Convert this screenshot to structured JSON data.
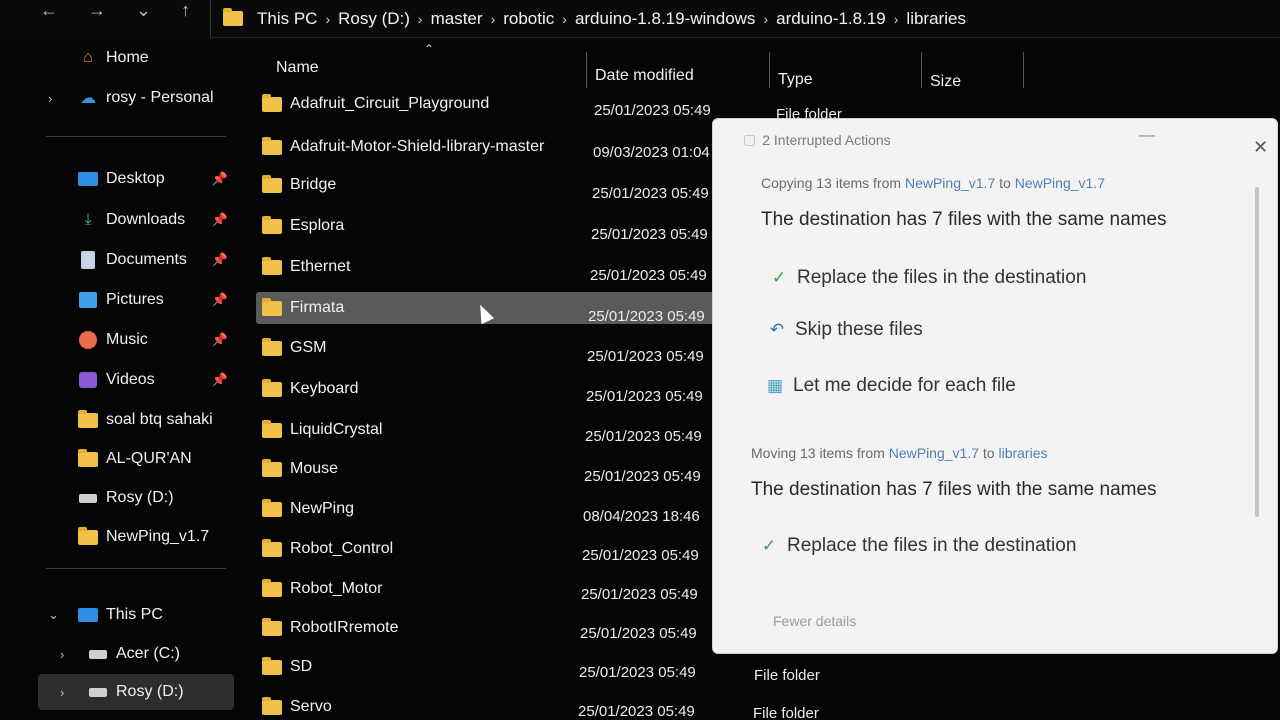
{
  "address_bar": {
    "crumbs": [
      "This PC",
      "Rosy (D:)",
      "master",
      "robotic",
      "arduino-1.8.19-windows",
      "arduino-1.8.19",
      "libraries"
    ]
  },
  "sidebar": {
    "home": "Home",
    "onedrive": "rosy - Personal",
    "pinned": [
      {
        "label": "Desktop",
        "icon": "desktop-icon"
      },
      {
        "label": "Downloads",
        "icon": "download-icon"
      },
      {
        "label": "Documents",
        "icon": "documents-icon"
      },
      {
        "label": "Pictures",
        "icon": "pictures-icon"
      },
      {
        "label": "Music",
        "icon": "music-icon"
      },
      {
        "label": "Videos",
        "icon": "videos-icon"
      }
    ],
    "folders": [
      "soal btq sahaki",
      "AL-QUR'AN",
      "Rosy (D:)",
      "NewPing_v1.7"
    ],
    "this_pc": "This PC",
    "drives": [
      "Acer (C:)",
      "Rosy (D:)"
    ]
  },
  "columns": {
    "name": "Name",
    "date": "Date modified",
    "type": "Type",
    "size": "Size"
  },
  "files": [
    {
      "name": "Adafruit_Circuit_Playground",
      "date": "25/01/2023 05:49"
    },
    {
      "name": "Adafruit-Motor-Shield-library-master",
      "date": "09/03/2023 01:04"
    },
    {
      "name": "Bridge",
      "date": "25/01/2023 05:49"
    },
    {
      "name": "Esplora",
      "date": "25/01/2023 05:49"
    },
    {
      "name": "Ethernet",
      "date": "25/01/2023 05:49"
    },
    {
      "name": "Firmata",
      "date": "25/01/2023 05:49"
    },
    {
      "name": "GSM",
      "date": "25/01/2023 05:49"
    },
    {
      "name": "Keyboard",
      "date": "25/01/2023 05:49"
    },
    {
      "name": "LiquidCrystal",
      "date": "25/01/2023 05:49"
    },
    {
      "name": "Mouse",
      "date": "25/01/2023 05:49"
    },
    {
      "name": "NewPing",
      "date": "08/04/2023 18:46"
    },
    {
      "name": "Robot_Control",
      "date": "25/01/2023 05:49"
    },
    {
      "name": "Robot_Motor",
      "date": "25/01/2023 05:49"
    },
    {
      "name": "RobotIRremote",
      "date": "25/01/2023 05:49"
    },
    {
      "name": "SD",
      "date": "25/01/2023 05:49"
    },
    {
      "name": "Servo",
      "date": "25/01/2023 05:49"
    }
  ],
  "file_type_visible": "File folder",
  "dialog": {
    "title": "2 Interrupted Actions",
    "copy_prefix": "Copying 13 items from",
    "copy_src": "NewPing_v1.7",
    "copy_to": "to",
    "copy_dst": "NewPing_v1.7",
    "copy_head": "The destination has 7 files with the same names",
    "opt_replace": "Replace the files in the destination",
    "opt_skip": "Skip these files",
    "opt_decide": "Let me decide for each file",
    "move_prefix": "Moving 13 items from",
    "move_src": "NewPing_v1.7",
    "move_to": "to",
    "move_dst": "libraries",
    "move_head": "The destination has 7 files with the same names",
    "opt_replace2": "Replace the files in the destination",
    "fewer": "Fewer details"
  }
}
